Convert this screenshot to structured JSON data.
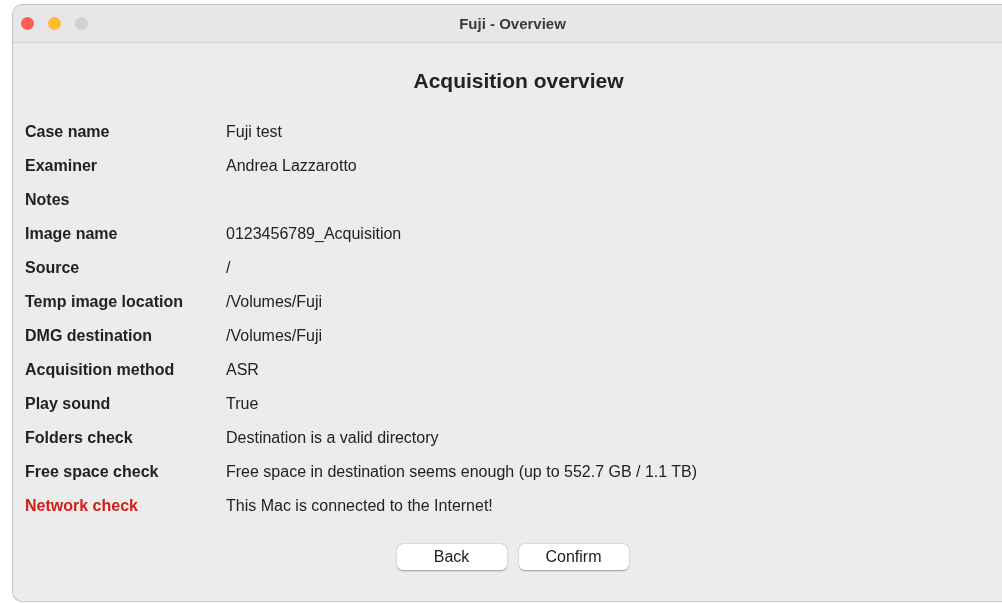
{
  "window": {
    "title": "Fuji - Overview",
    "traffic_lights": [
      {
        "color": "#fe5f57"
      },
      {
        "color": "#febc2e"
      },
      {
        "color": "#d0d0d0"
      }
    ]
  },
  "heading": "Acquisition overview",
  "rows": [
    {
      "label": "Case name",
      "value": "Fuji test",
      "alert": false
    },
    {
      "label": "Examiner",
      "value": "Andrea Lazzarotto",
      "alert": false
    },
    {
      "label": "Notes",
      "alert": false
    },
    {
      "label": "Image name",
      "value": "0123456789_Acquisition",
      "alert": false
    },
    {
      "label": "Source",
      "value": "/",
      "alert": false
    },
    {
      "label": "Temp image location",
      "value": "/Volumes/Fuji",
      "alert": false
    },
    {
      "label": "DMG destination",
      "value": "/Volumes/Fuji",
      "alert": false
    },
    {
      "label": "Acquisition method",
      "value": "ASR",
      "alert": false
    },
    {
      "label": "Play sound",
      "value": "True",
      "alert": false
    },
    {
      "label": "Folders check",
      "value": "Destination is a valid directory",
      "alert": false
    },
    {
      "label": "Free space check",
      "value": "Free space in destination seems enough (up to 552.7 GB / 1.1 TB)",
      "alert": false
    },
    {
      "label": "Network check",
      "value": "This Mac is connected to the Internet!",
      "alert": true
    }
  ],
  "buttons": [
    "Back",
    "Confirm"
  ]
}
